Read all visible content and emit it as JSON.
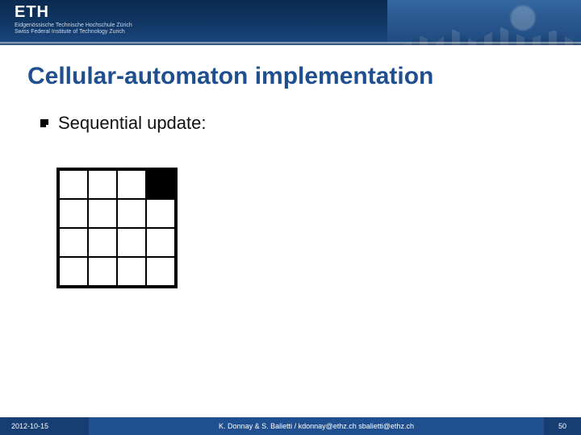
{
  "header": {
    "logo_text": "ETH",
    "subline": "Eidgenössische Technische Hochschule Zürich\nSwiss Federal Institute of Technology Zurich"
  },
  "title": "Cellular-automaton implementation",
  "bullet": {
    "text": "Sequential update:"
  },
  "grid": {
    "rows": 4,
    "cols": 4,
    "filled_row": 0,
    "filled_col": 3
  },
  "footer": {
    "date": "2012-10-15",
    "credits": "K. Donnay & S. Balietti  /  kdonnay@ethz.ch   sbalietti@ethz.ch",
    "page": "50"
  }
}
